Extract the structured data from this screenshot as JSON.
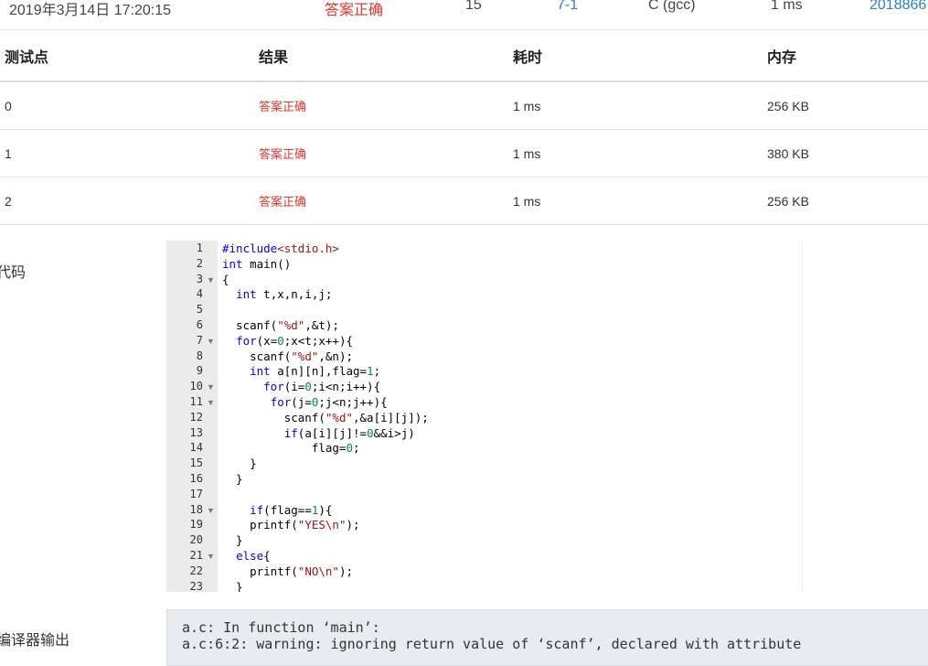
{
  "submission": {
    "time": "2019年3月14日 17:20:15",
    "status": "答案正确",
    "score": "15",
    "problem": "7-1",
    "compiler": "C (gcc)",
    "time_used": "1 ms",
    "user": "2018866"
  },
  "cases_table": {
    "headers": [
      "测试点",
      "结果",
      "耗时",
      "内存"
    ],
    "rows": [
      {
        "id": "0",
        "result": "答案正确",
        "time": "1 ms",
        "memory": "256 KB"
      },
      {
        "id": "1",
        "result": "答案正确",
        "time": "1 ms",
        "memory": "380 KB"
      },
      {
        "id": "2",
        "result": "答案正确",
        "time": "1 ms",
        "memory": "256 KB"
      }
    ]
  },
  "code_label": "代码",
  "code_lines": [
    {
      "n": "1",
      "text": "#include<stdio.h>"
    },
    {
      "n": "2",
      "text": "int main()"
    },
    {
      "n": "3",
      "text": "{",
      "fold": true
    },
    {
      "n": "4",
      "text": "  int t,x,n,i,j;"
    },
    {
      "n": "5",
      "text": ""
    },
    {
      "n": "6",
      "text": "  scanf(\"%d\",&t);"
    },
    {
      "n": "7",
      "text": "  for(x=0;x<t;x++){",
      "fold": true
    },
    {
      "n": "8",
      "text": "    scanf(\"%d\",&n);"
    },
    {
      "n": "9",
      "text": "    int a[n][n],flag=1;"
    },
    {
      "n": "10",
      "text": "      for(i=0;i<n;i++){",
      "fold": true
    },
    {
      "n": "11",
      "text": "       for(j=0;j<n;j++){",
      "fold": true
    },
    {
      "n": "12",
      "text": "         scanf(\"%d\",&a[i][j]);"
    },
    {
      "n": "13",
      "text": "         if(a[i][j]!=0&&i>j)"
    },
    {
      "n": "14",
      "text": "             flag=0;"
    },
    {
      "n": "15",
      "text": "    }"
    },
    {
      "n": "16",
      "text": "  }"
    },
    {
      "n": "17",
      "text": ""
    },
    {
      "n": "18",
      "text": "    if(flag==1){",
      "fold": true
    },
    {
      "n": "19",
      "text": "    printf(\"YES\\n\");"
    },
    {
      "n": "20",
      "text": "  }"
    },
    {
      "n": "21",
      "text": "  else{",
      "fold": true
    },
    {
      "n": "22",
      "text": "    printf(\"NO\\n\");"
    },
    {
      "n": "23",
      "text": "  }"
    }
  ],
  "compiler_label": "编译器输出",
  "compiler_output": [
    "a.c: In function ‘main’:",
    "a.c:6:2: warning: ignoring return value of ‘scanf’, declared with attribute"
  ],
  "colors": {
    "accepted": "#e5362c",
    "link": "#2a7fd4",
    "gutter": "#ebebeb",
    "keyword": "#0000ff",
    "string": "#a31515",
    "number": "#09885a"
  }
}
